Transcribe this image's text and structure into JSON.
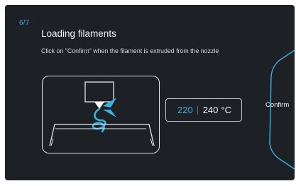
{
  "header": {
    "step": "6/7",
    "title": "Loading filaments",
    "instruction": "Click on \"Confirm\" when the filament is extruded from the nozzle"
  },
  "illustration": {
    "icon": "extruder-nozzle-illustration"
  },
  "temperature": {
    "current": "220",
    "target": "240",
    "unit": "°C"
  },
  "confirm": {
    "label": "Confirm"
  },
  "colors": {
    "background": "#1d2126",
    "accent": "#3bb0e3",
    "text": "#f2f2f2"
  }
}
